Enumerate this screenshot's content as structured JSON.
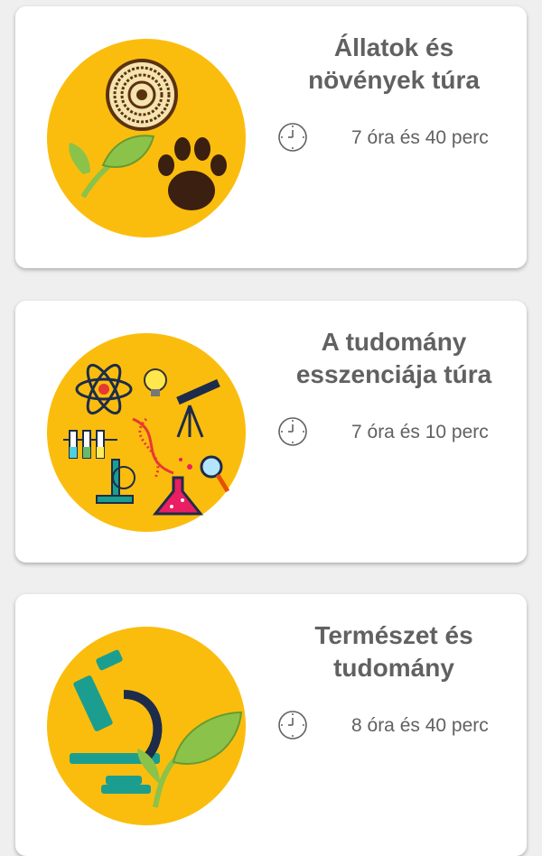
{
  "tours": [
    {
      "title_line1": "Állatok és",
      "title_line2": "növények túra",
      "duration": "7 óra és 40 perc",
      "image_icon": "animals-plants-illustration"
    },
    {
      "title_line1": "A tudomány",
      "title_line2": "esszenciája túra",
      "duration": "7 óra és 10 perc",
      "image_icon": "science-essence-illustration"
    },
    {
      "title_line1": "Természet és",
      "title_line2": "tudomány",
      "duration": "8 óra és 40 perc",
      "image_icon": "nature-science-illustration"
    }
  ],
  "colors": {
    "background": "#efefef",
    "card": "#ffffff",
    "circle": "#fbbd0d",
    "text": "#616161",
    "leaf": "#8bc34a",
    "microscope": "#1b9e8f"
  },
  "clock_icon": "clock-icon"
}
